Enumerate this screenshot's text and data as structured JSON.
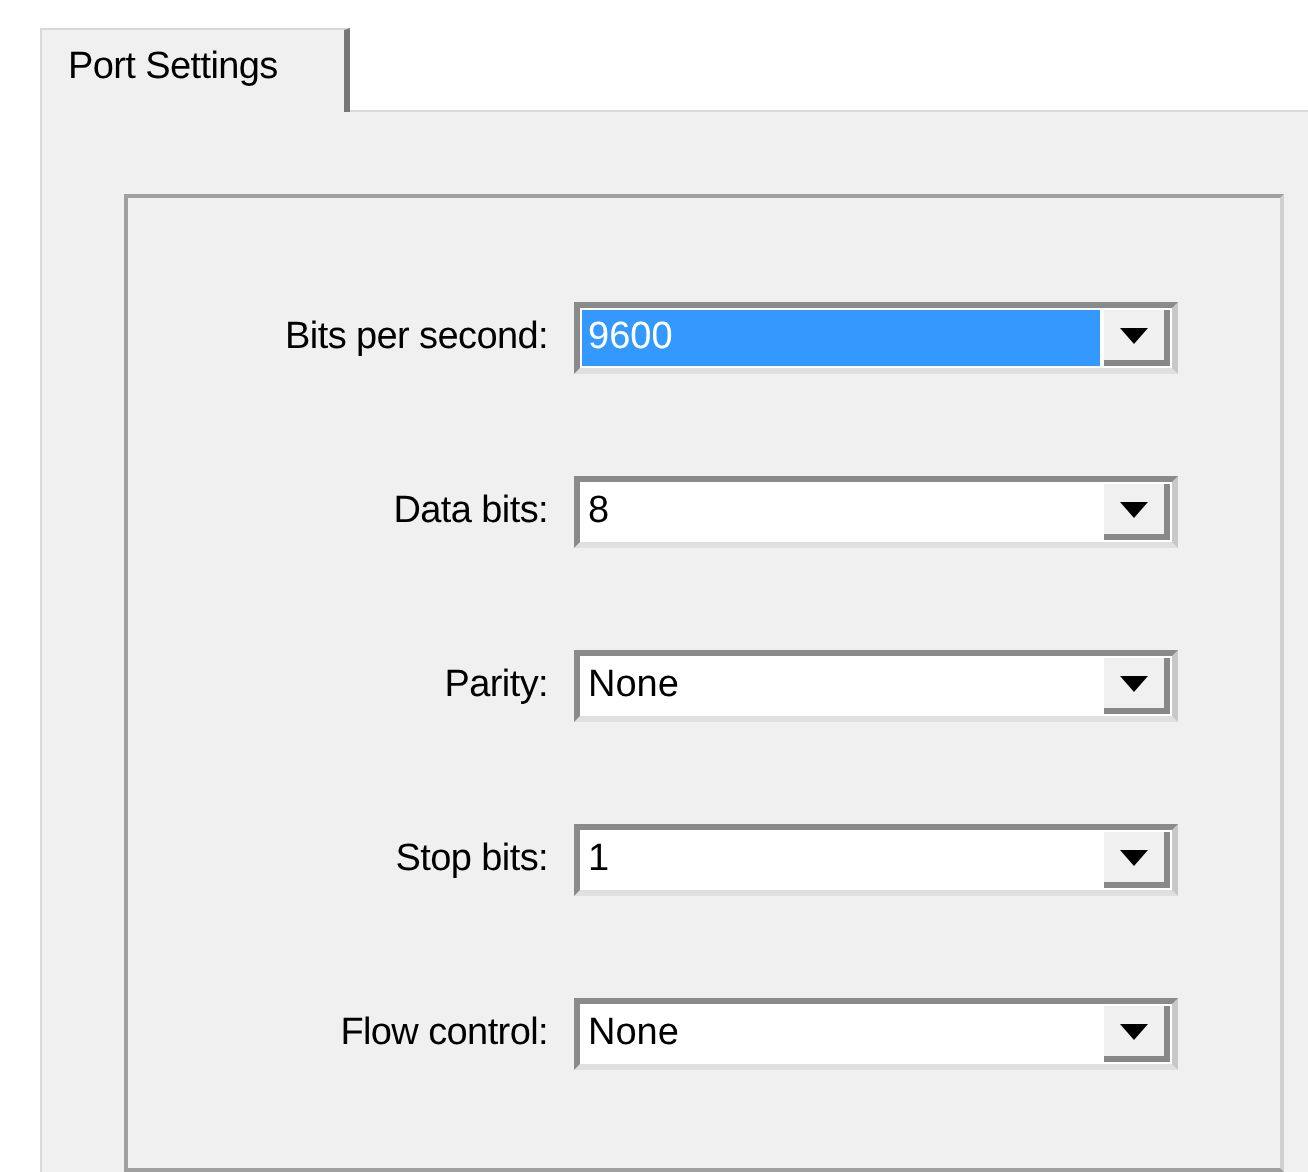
{
  "tabs": [
    {
      "label": "Port Settings",
      "selected": true
    }
  ],
  "fields": [
    {
      "label": "Bits per second:",
      "value": "9600",
      "focused": true
    },
    {
      "label": "Data bits:",
      "value": "8",
      "focused": false
    },
    {
      "label": "Parity:",
      "value": "None",
      "focused": false
    },
    {
      "label": "Stop bits:",
      "value": "1",
      "focused": false
    },
    {
      "label": "Flow control:",
      "value": "None",
      "focused": false
    }
  ]
}
